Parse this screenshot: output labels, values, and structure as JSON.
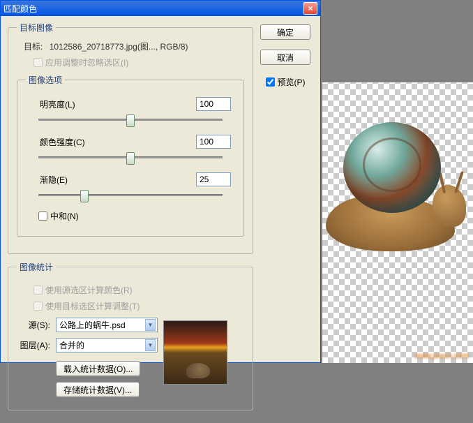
{
  "titlebar": {
    "title": "匹配颜色",
    "close": "×"
  },
  "target_group": {
    "legend": "目标图像",
    "target_prefix": "目标:",
    "target_value": "1012586_20718773.jpg(图..., RGB/8)",
    "apply_ignore": "应用调整时忽略选区(I)"
  },
  "options_group": {
    "legend": "图像选项",
    "luminance_label": "明亮度(L)",
    "luminance_value": "100",
    "intensity_label": "颜色强度(C)",
    "intensity_value": "100",
    "fade_label": "渐隐(E)",
    "fade_value": "25",
    "neutralize": "中和(N)"
  },
  "stats_group": {
    "legend": "图像统计",
    "use_src_sel": "使用源选区计算颜色(R)",
    "use_tgt_sel": "使用目标选区计算调整(T)",
    "source_label": "源(S):",
    "source_value": "公路上的蜗牛.psd",
    "layer_label": "图层(A):",
    "layer_value": "合并的",
    "load_btn": "载入统计数据(O)...",
    "save_btn": "存储统计数据(V)..."
  },
  "buttons": {
    "ok": "确定",
    "cancel": "取消",
    "preview": "预览(P)"
  },
  "watermark": "www.jcwcn.com"
}
